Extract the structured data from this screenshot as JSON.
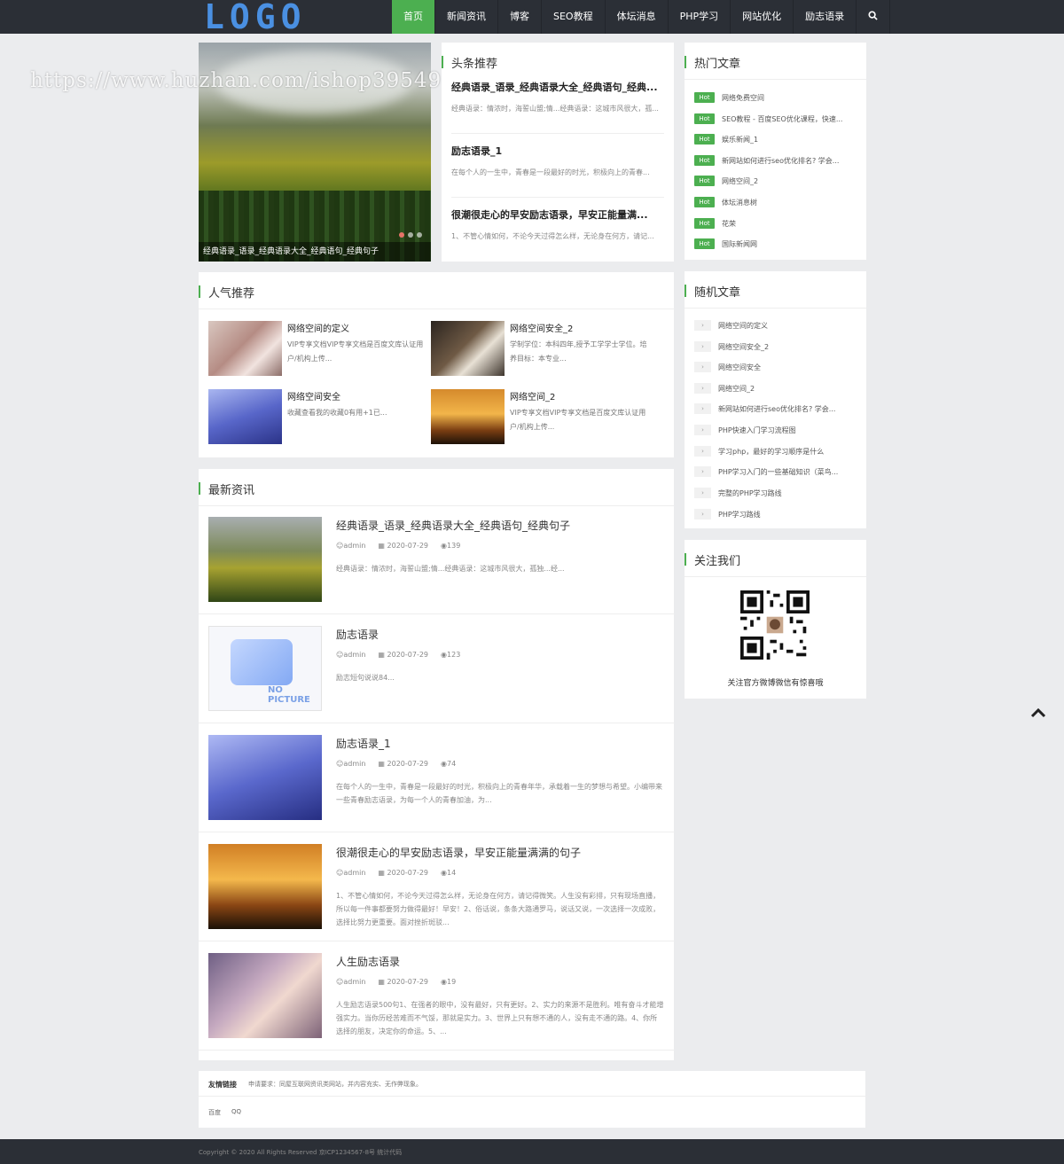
{
  "header": {
    "logo": "LOGO",
    "nav": [
      "首页",
      "新闻资讯",
      "博客",
      "SEO教程",
      "体坛消息",
      "PHP学习",
      "网站优化",
      "励志语录"
    ],
    "search_icon": "search-icon"
  },
  "watermark": "https://www.huzhan.com/ishop39549",
  "slider": {
    "caption": "经典语录_语录_经典语录大全_经典语句_经典句子",
    "dots": 3,
    "active_dot": 0
  },
  "headlines": {
    "title": "头条推荐",
    "items": [
      {
        "title": "经典语录_语录_经典语录大全_经典语句_经典...",
        "desc": "经典语录：情浓时，海誓山盟;情...经典语录：这城市风很大，孤..."
      },
      {
        "title": "励志语录_1",
        "desc": "在每个人的一生中，青春是一段最好的时光，积极向上的青春..."
      },
      {
        "title": "很潮很走心的早安励志语录，早安正能量满...",
        "desc": "1、不管心情如何，不论今天过得怎么样，无论身在何方，请记..."
      }
    ]
  },
  "hot": {
    "title": "热门文章",
    "badge": "Hot",
    "items": [
      "网络免费空间",
      "SEO教程 - 百度SEO优化课程，快速...",
      "娱乐新闻_1",
      "新网站如何进行seo优化排名? 学会...",
      "网络空间_2",
      "体坛消息树",
      "花荣",
      "国际新闻网"
    ]
  },
  "popular": {
    "title": "人气推荐",
    "items": [
      {
        "title": "网络空间的定义",
        "desc": "VIP专享文档VIP专享文档是百度文库认证用户/机构上传..."
      },
      {
        "title": "网络空间安全_2",
        "desc": "学制学位：本科四年,授予工学学士学位。培养目标：本专业..."
      },
      {
        "title": "网络空间安全",
        "desc": "收藏查看我的收藏0有用+1已..."
      },
      {
        "title": "网络空间_2",
        "desc": "VIP专享文档VIP专享文档是百度文库认证用户/机构上传..."
      }
    ]
  },
  "latest": {
    "title": "最新资讯",
    "items": [
      {
        "title": "经典语录_语录_经典语录大全_经典语句_经典句子",
        "author": "admin",
        "date": "2020-07-29",
        "views": "139",
        "desc": "经典语录：情浓时，海誓山盟;情...经典语录：这城市风很大，孤独...经..."
      },
      {
        "title": "励志语录",
        "author": "admin",
        "date": "2020-07-29",
        "views": "123",
        "desc": "励志短句说说84..."
      },
      {
        "title": "励志语录_1",
        "author": "admin",
        "date": "2020-07-29",
        "views": "74",
        "desc": "在每个人的一生中，青春是一段最好的时光，积极向上的青春年华，承载着一生的梦想与希望。小编带来一些青春励志语录，为每一个人的青春加油，为..."
      },
      {
        "title": "很潮很走心的早安励志语录，早安正能量满满的句子",
        "author": "admin",
        "date": "2020-07-29",
        "views": "14",
        "desc": "1、不管心情如何，不论今天过得怎么样，无论身在何方，请记得微笑。人生没有彩排，只有现场直播，所以每一件事都要努力做得最好！早安！2、俗话说，条条大路通罗马，说话又说，一次选择一次成败，选择比努力更重要。面对挫折斑驳..."
      },
      {
        "title": "人生励志语录",
        "author": "admin",
        "date": "2020-07-29",
        "views": "19",
        "desc": "人生励志语录500句1、在强者的眼中，没有最好，只有更好。2、实力的来源不是胜利。唯有奋斗才能增强实力。当你历经苦难而不气馁，那就是实力。3、世界上只有想不通的人，没有走不通的路。4、你所选择的朋友，决定你的命运。5、..."
      }
    ],
    "no_picture": "NO PICTURE"
  },
  "random": {
    "title": "随机文章",
    "items": [
      "网络空间的定义",
      "网络空间安全_2",
      "网络空间安全",
      "网络空间_2",
      "新网站如何进行seo优化排名? 学会...",
      "PHP快速入门学习流程图",
      "学习php，最好的学习顺序是什么",
      "PHP学习入门的一些基础知识（菜鸟...",
      "完整的PHP学习路线",
      "PHP学习路线"
    ]
  },
  "follow": {
    "title": "关注我们",
    "caption": "关注官方微博微信有惊喜哦"
  },
  "links": {
    "label": "友情链接",
    "requirement": "申请要求：同屋互联网资讯类网站，并内容充实、无作弊现象。",
    "items": [
      "百度",
      "QQ"
    ]
  },
  "footer": {
    "text": "Copyright © 2020 All Rights Reserved 京ICP1234567-8号 统计代码"
  }
}
